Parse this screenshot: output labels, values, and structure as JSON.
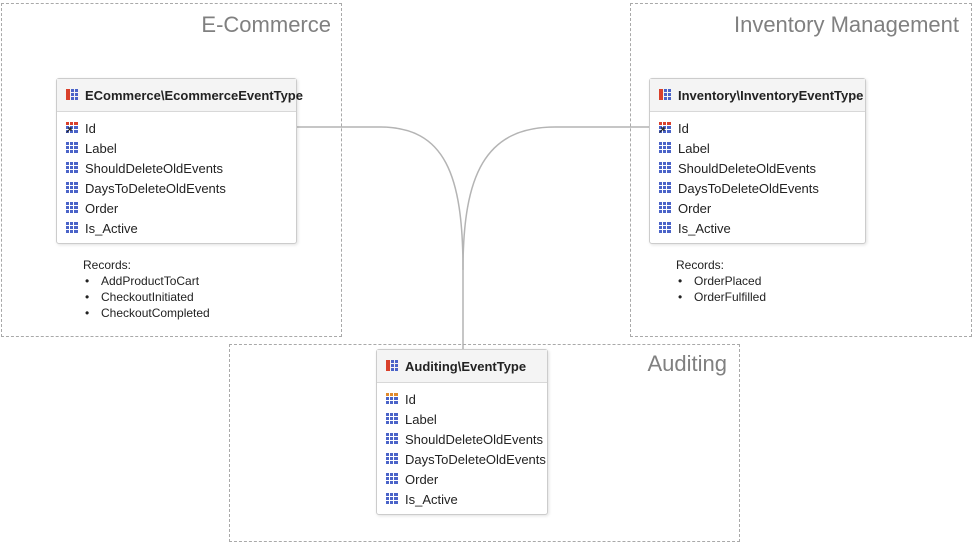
{
  "regions": {
    "ecommerce": {
      "title": "E-Commerce"
    },
    "inventory": {
      "title": "Inventory Management"
    },
    "auditing": {
      "title": "Auditing"
    }
  },
  "entities": {
    "ecommerce": {
      "name": "ECommerce\\EcommerceEventType",
      "fields": [
        "Id",
        "Label",
        "ShouldDeleteOldEvents",
        "DaysToDeleteOldEvents",
        "Order",
        "Is_Active"
      ]
    },
    "inventory": {
      "name": "Inventory\\InventoryEventType",
      "fields": [
        "Id",
        "Label",
        "ShouldDeleteOldEvents",
        "DaysToDeleteOldEvents",
        "Order",
        "Is_Active"
      ]
    },
    "auditing": {
      "name": "Auditing\\EventType",
      "fields": [
        "Id",
        "Label",
        "ShouldDeleteOldEvents",
        "DaysToDeleteOldEvents",
        "Order",
        "Is_Active"
      ]
    }
  },
  "records": {
    "ecommerce": {
      "heading": "Records:",
      "items": [
        "AddProductToCart",
        "CheckoutInitiated",
        "CheckoutCompleted"
      ]
    },
    "inventory": {
      "heading": "Records:",
      "items": [
        "OrderPlaced",
        "OrderFulfilled"
      ]
    }
  },
  "icons": {
    "entity": "table-icon",
    "field": "attribute-icon",
    "foreign_key": "foreign-key-icon",
    "primary_key": "primary-key-icon"
  },
  "colors": {
    "region_border": "#a9a9a9",
    "region_title": "#808080",
    "connector": "#b4b4b4",
    "icon_blue": "#4a63c8",
    "icon_red": "#d9402b",
    "icon_orange": "#e08a2c"
  }
}
